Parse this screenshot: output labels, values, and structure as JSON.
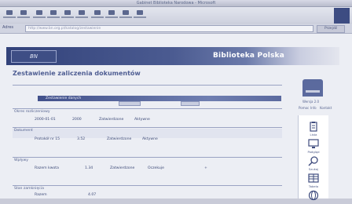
{
  "window": {
    "title": "Gabinet Biblioteka Narodowa - Microsoft"
  },
  "toolbar": {
    "buttons": [
      "back",
      "forward",
      "stop",
      "refresh",
      "home",
      "search",
      "favorites",
      "history",
      "mail",
      "print"
    ]
  },
  "address": {
    "label": "Adres",
    "value": "http://www.bn.org.pl/katalog/zestawienie",
    "go_label": "Przejdź"
  },
  "banner": {
    "logo": "BN",
    "title": "Biblioteka Polska"
  },
  "page": {
    "title": "Zestawienie zaliczenia dokumentów"
  },
  "content": {
    "tab_bar": "Zestawienie danych",
    "sections": [
      {
        "title": "Okres rozliczeniowy",
        "values": [
          "2000-01-01",
          "2000",
          "Zatwierdzone",
          "Aktywne"
        ]
      },
      {
        "title": "Dokument",
        "values": [
          "Protokół nr 15",
          "3.52",
          "Zatwierdzone",
          "Aktywne"
        ]
      },
      {
        "title": "Wpływy",
        "values": [
          "Razem kwota",
          "1.34",
          "Zatwierdzone",
          "Oczekuje",
          "+"
        ]
      },
      {
        "title": "Stan zamknięcia",
        "values": [
          "Razem",
          "4.07"
        ]
      }
    ]
  },
  "sidebar": {
    "meta": "Wersja 2.0",
    "links": [
      "Pomoc",
      "Info",
      "Kontakt"
    ],
    "icons": [
      {
        "name": "clipboard-icon",
        "label": "Lista"
      },
      {
        "name": "monitor-icon",
        "label": "Podgląd"
      },
      {
        "name": "search-icon",
        "label": "Szukaj"
      },
      {
        "name": "table-icon",
        "label": "Tabela"
      },
      {
        "name": "globe-icon",
        "label": "Sieć"
      }
    ]
  },
  "colors": {
    "accent": "#3d4c82",
    "banner": "#32427a",
    "title": "#4f5e93"
  }
}
